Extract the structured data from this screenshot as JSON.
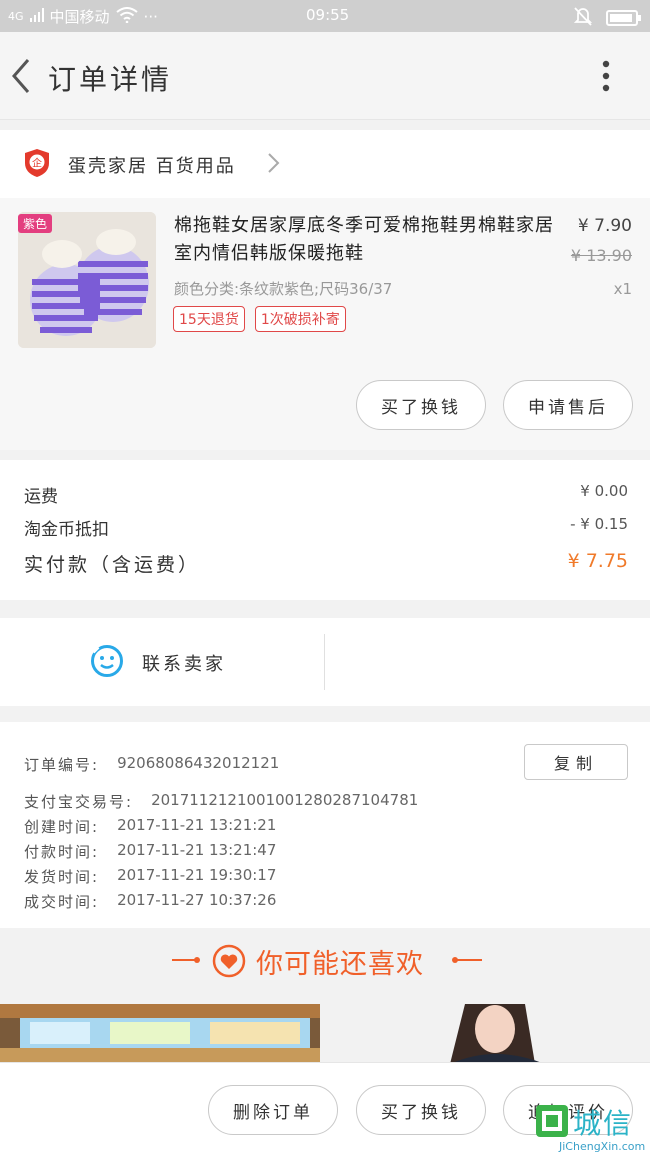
{
  "status_bar": {
    "carrier": "中国移动",
    "network": "4G",
    "dots": "···",
    "time": "09:55"
  },
  "header": {
    "title": "订单详情"
  },
  "shop": {
    "name": "蛋壳家居 百货用品",
    "badge": "企"
  },
  "item": {
    "color_tag": "紫色",
    "name": "棉拖鞋女居家厚底冬季可爱棉拖鞋男棉鞋家居室内情侣韩版保暖拖鞋",
    "price": "¥ 7.90",
    "original_price": "¥ 13.90",
    "sku": "颜色分类:条纹款紫色;尺码36/37",
    "quantity": "x1",
    "tags": [
      "15天退货",
      "1次破损补寄"
    ],
    "buttons": {
      "buy_again": "买了换钱",
      "after_sale": "申请售后"
    }
  },
  "fees": {
    "shipping_label": "运费",
    "shipping_value": "¥ 0.00",
    "coin_label": "淘金币抵扣",
    "coin_value": "- ¥ 0.15",
    "total_label": "实付款（含运费）",
    "total_value": "¥ 7.75"
  },
  "contact": {
    "label": "联系卖家"
  },
  "order_meta": {
    "copy_label": "复制",
    "rows": [
      {
        "key": "订单编号:",
        "value": "92068086432012121"
      },
      {
        "key": "支付宝交易号:",
        "value": "2017112121001001280287104781"
      },
      {
        "key": "创建时间:",
        "value": "2017-11-21 13:21:21"
      },
      {
        "key": "付款时间:",
        "value": "2017-11-21 13:21:47"
      },
      {
        "key": "发货时间:",
        "value": "2017-11-21 19:30:17"
      },
      {
        "key": "成交时间:",
        "value": "2017-11-27 10:37:26"
      }
    ]
  },
  "recommend": {
    "title": "你可能还喜欢"
  },
  "bottom_bar": {
    "delete": "删除订单",
    "buy_again": "买了换钱",
    "add_review": "追加评价"
  },
  "watermark": {
    "text": "城信",
    "sub": "JiChengXin.com"
  },
  "colors": {
    "accent": "#f0602a",
    "tag_red": "#e04848",
    "contact_blue": "#29a9e8",
    "status_bar": "#cfcfcf"
  }
}
